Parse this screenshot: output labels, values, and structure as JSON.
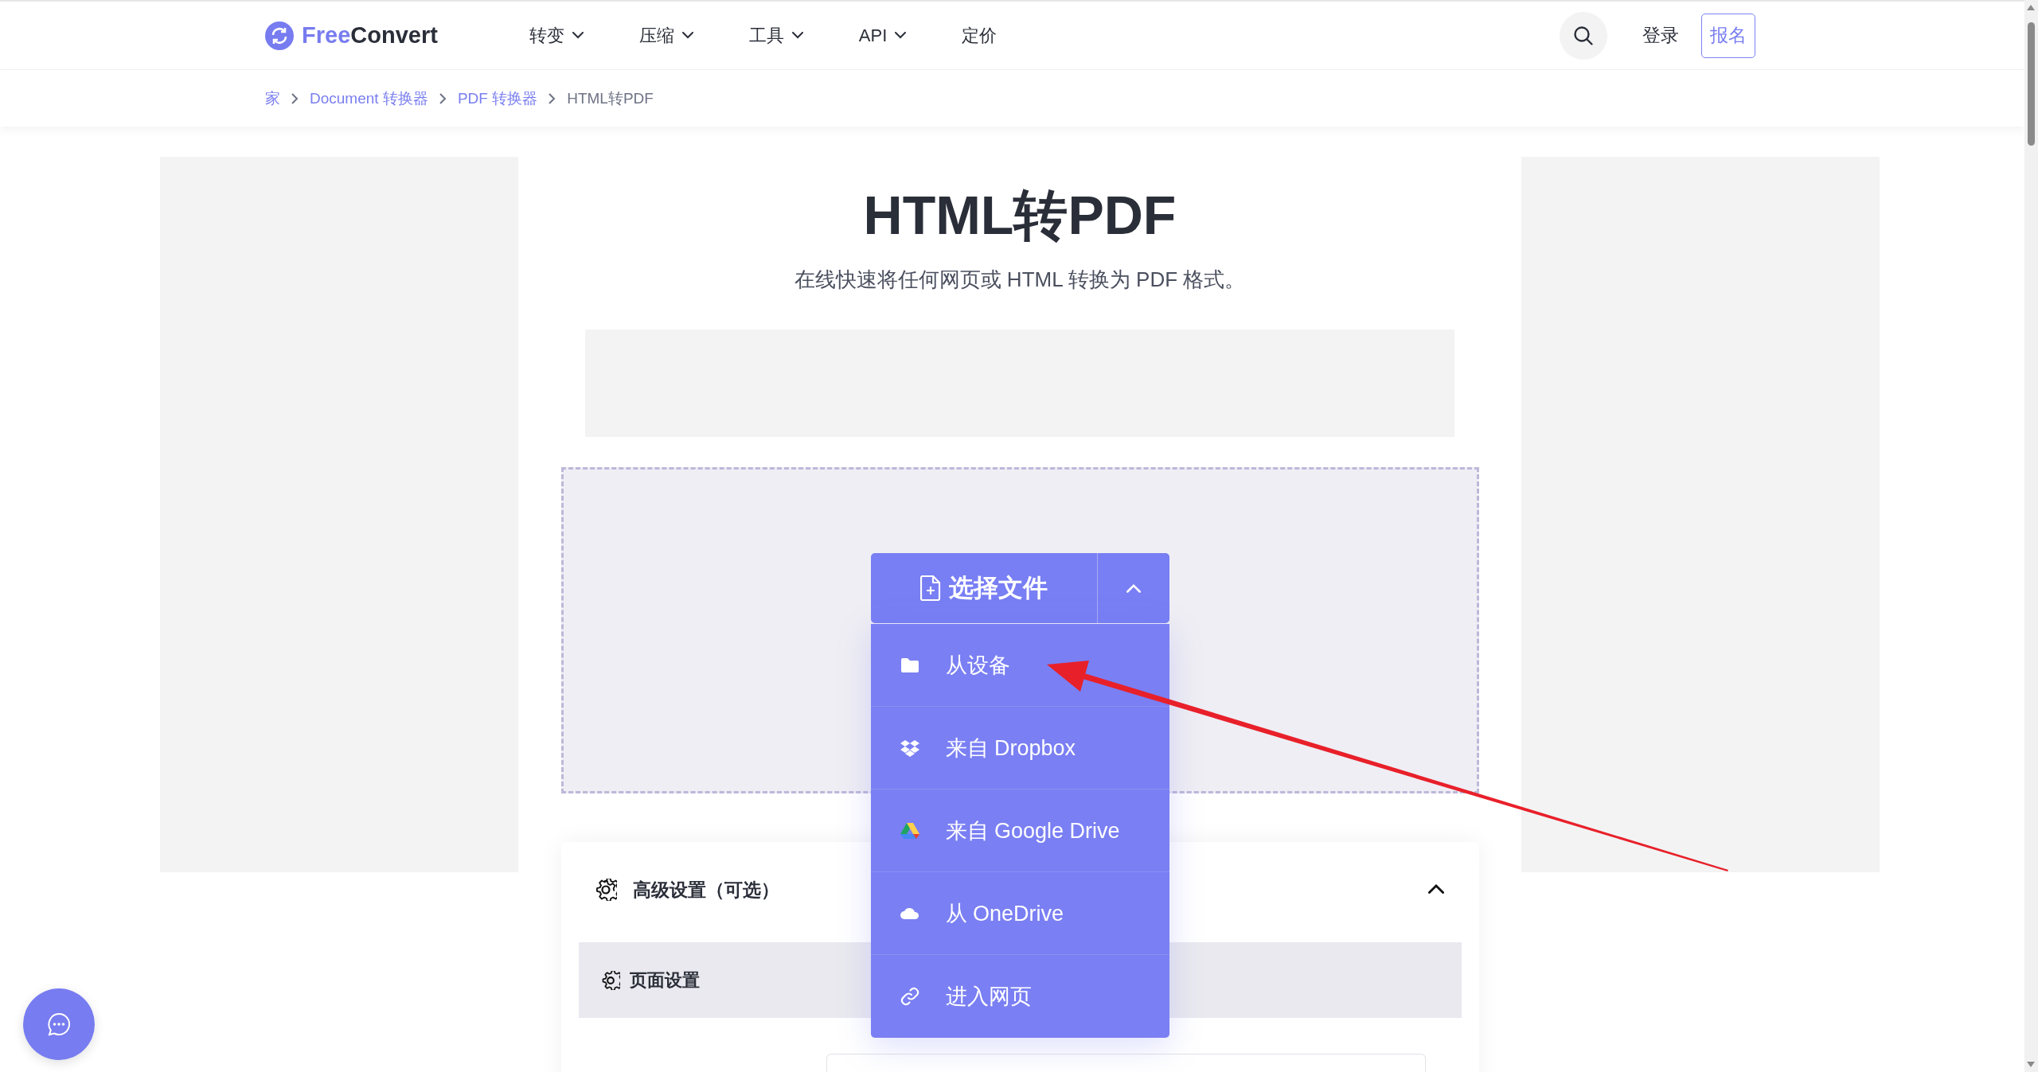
{
  "header": {
    "logo": {
      "first": "Free",
      "second": "Convert"
    },
    "nav": [
      {
        "label": "转变",
        "has_menu": true
      },
      {
        "label": "压缩",
        "has_menu": true
      },
      {
        "label": "工具",
        "has_menu": true
      },
      {
        "label": "API",
        "has_menu": true
      },
      {
        "label": "定价",
        "has_menu": false
      }
    ],
    "login": "登录",
    "signup": "报名"
  },
  "breadcrumb": [
    {
      "label": "家",
      "current": false
    },
    {
      "label": "Document 转换器",
      "current": false
    },
    {
      "label": "PDF 转换器",
      "current": false
    },
    {
      "label": "HTML转PDF",
      "current": true
    }
  ],
  "title": "HTML转PDF",
  "subtitle": "在线快速将任何网页或 HTML 转换为 PDF 格式。",
  "upload": {
    "button": "选择文件",
    "expanded": true,
    "menu": [
      {
        "kind": "device",
        "label": "从设备"
      },
      {
        "kind": "dropbox",
        "label": "来自 Dropbox"
      },
      {
        "kind": "gdrive",
        "label": "来自 Google Drive"
      },
      {
        "kind": "onedrive",
        "label": "从 OneDrive"
      },
      {
        "kind": "url",
        "label": "进入网页"
      }
    ]
  },
  "settings": {
    "title": "高级设置（可选）",
    "expanded": true,
    "section": "页面设置"
  }
}
